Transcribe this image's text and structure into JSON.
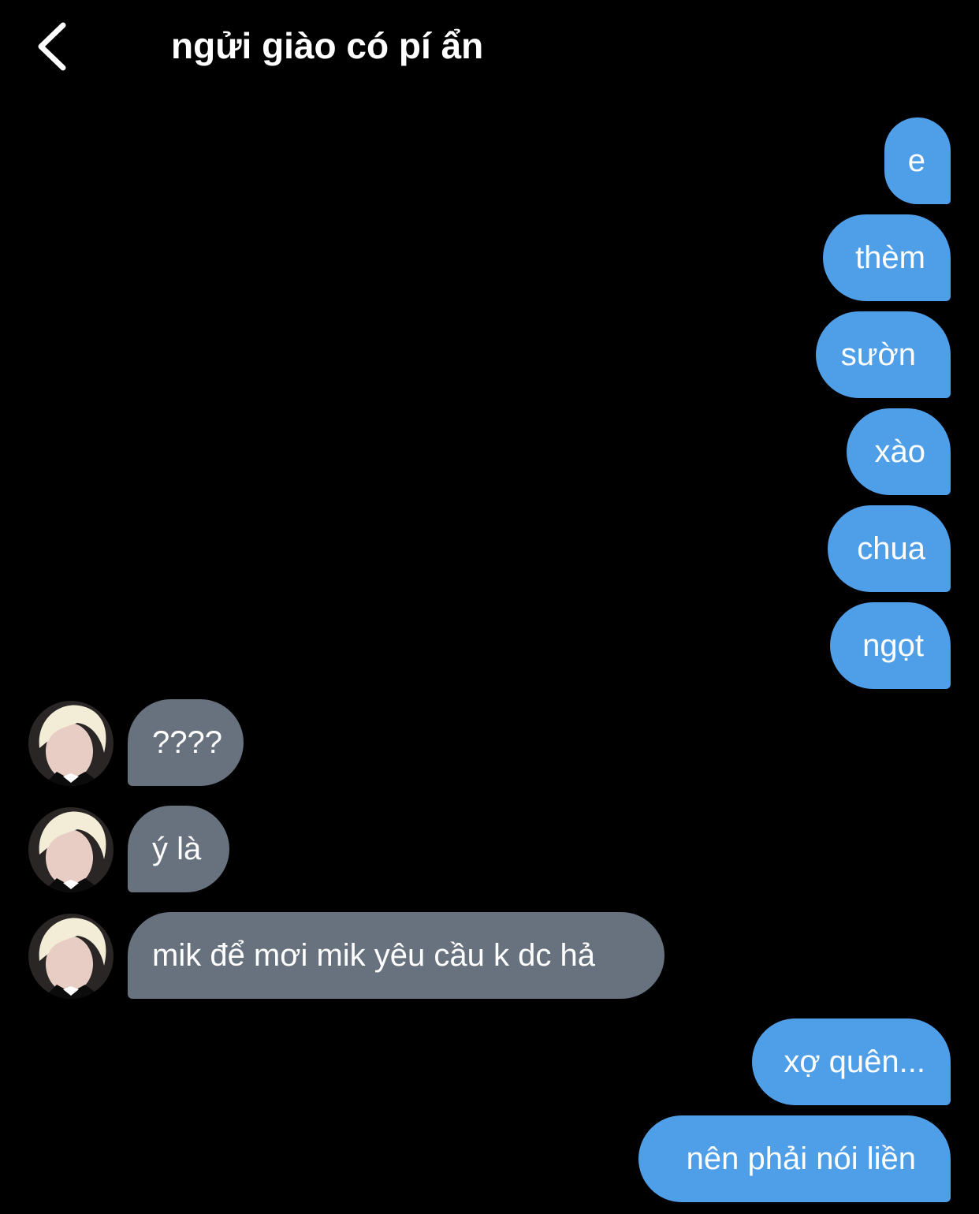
{
  "header": {
    "back_icon": "chevron-left-icon",
    "title": "ngửi giào có pí ẩn"
  },
  "messages": [
    {
      "direction": "outgoing",
      "text": "e"
    },
    {
      "direction": "outgoing",
      "text": "thèm"
    },
    {
      "direction": "outgoing",
      "text": "sườn"
    },
    {
      "direction": "outgoing",
      "text": "xào"
    },
    {
      "direction": "outgoing",
      "text": "chua"
    },
    {
      "direction": "outgoing",
      "text": "ngọt"
    },
    {
      "direction": "incoming",
      "text": "????"
    },
    {
      "direction": "incoming",
      "text": "ý là"
    },
    {
      "direction": "incoming",
      "text": "mik để mơi mik yêu cầu k dc hả"
    },
    {
      "direction": "outgoing",
      "text": "xợ quên..."
    },
    {
      "direction": "outgoing",
      "text": "nên phải nói liền"
    }
  ],
  "colors": {
    "background": "#000000",
    "outgoing_bubble": "#4f9ee8",
    "incoming_bubble": "#67727e",
    "text": "#ffffff"
  }
}
